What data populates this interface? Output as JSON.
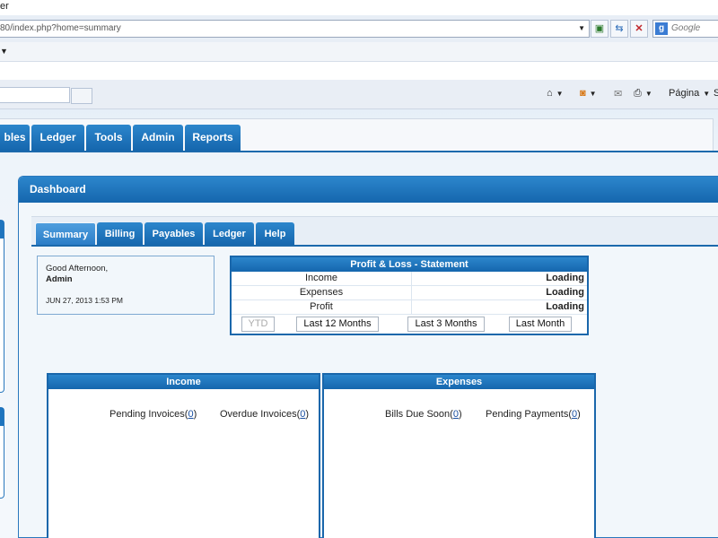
{
  "browser": {
    "title_fragment": "er",
    "address": "80/index.php?home=summary",
    "search_placeholder": "Google",
    "page_menu": "Página",
    "page_menu_extra": "S"
  },
  "nav": {
    "tabs": [
      "bles",
      "Ledger",
      "Tools",
      "Admin",
      "Reports"
    ]
  },
  "dashboard": {
    "title": "Dashboard",
    "subtabs": [
      "Summary",
      "Billing",
      "Payables",
      "Ledger",
      "Help"
    ],
    "active_subtab": "Summary",
    "greeting": "Good Afternoon,",
    "user": "Admin",
    "datetime": "JUN 27, 2013 1:53 PM"
  },
  "profit_loss": {
    "title": "Profit & Loss - Statement",
    "rows": [
      {
        "label": "Income",
        "value": "Loading"
      },
      {
        "label": "Expenses",
        "value": "Loading"
      },
      {
        "label": "Profit",
        "value": "Loading"
      }
    ],
    "buttons": [
      "YTD",
      "Last 12 Months",
      "Last 3 Months",
      "Last Month"
    ]
  },
  "income": {
    "title": "Income",
    "links": [
      {
        "label": "Pending Invoices",
        "count": "0"
      },
      {
        "label": "Overdue Invoices",
        "count": "0"
      }
    ]
  },
  "expenses": {
    "title": "Expenses",
    "links": [
      {
        "label": "Bills Due Soon",
        "count": "0"
      },
      {
        "label": "Pending Payments",
        "count": "0"
      }
    ]
  }
}
